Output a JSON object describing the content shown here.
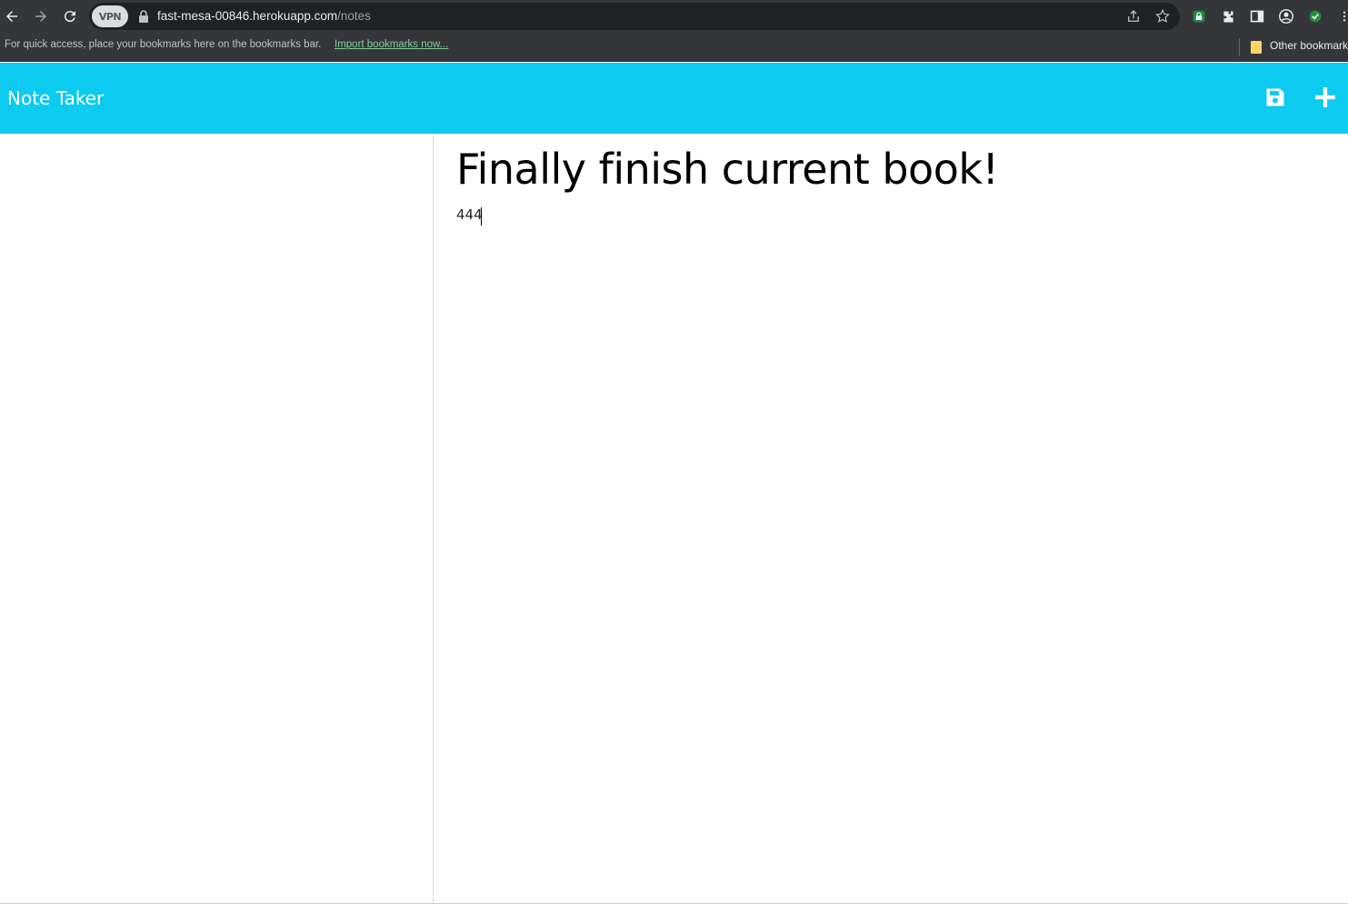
{
  "browser": {
    "vpn_label": "VPN",
    "url_host": "fast-mesa-00846.herokuapp.com",
    "url_path": "/notes",
    "bookmarks_bar_text": "For quick access, place your bookmarks here on the bookmarks bar.",
    "import_bookmarks_link": "Import bookmarks now...",
    "other_bookmarks": "Other bookmarks"
  },
  "app": {
    "title": "Note Taker",
    "save_icon": "save-icon",
    "add_icon": "plus-icon",
    "header_color": "#0dcaf0"
  },
  "note": {
    "title": "Finally finish current book!",
    "text": "444"
  }
}
